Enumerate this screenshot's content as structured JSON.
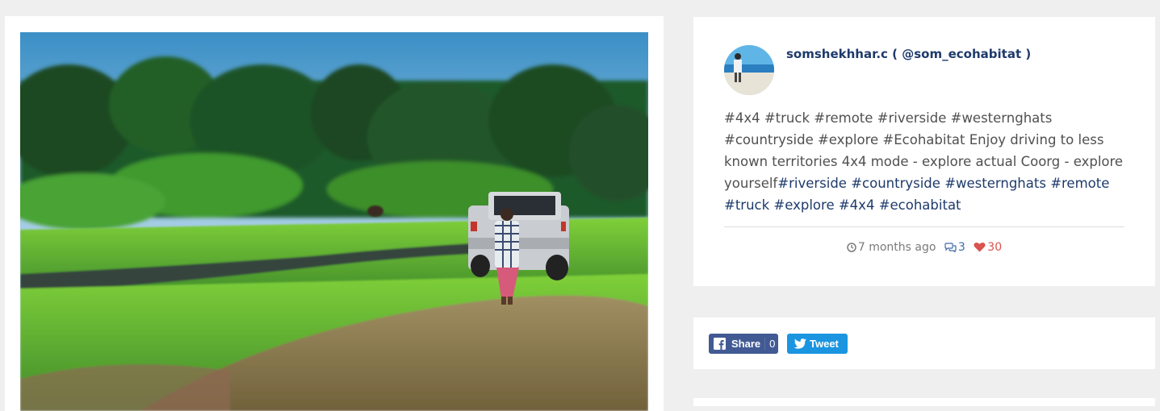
{
  "post": {
    "user_display": "somshekhhar.c ( @som_ecohabitat )",
    "caption_segments": [
      {
        "text": "#4x4 #truck #remote #riverside #westernghats #countryside #explore #Ecohabitat Enjoy driving to less known territories 4x4 mode - explore actual Coorg - explore yourself",
        "tag": false
      },
      {
        "text": "#riverside",
        "tag": true
      },
      {
        "text": " ",
        "tag": false
      },
      {
        "text": "#countryside",
        "tag": true
      },
      {
        "text": " ",
        "tag": false
      },
      {
        "text": "#westernghats",
        "tag": true
      },
      {
        "text": " ",
        "tag": false
      },
      {
        "text": "#remote",
        "tag": true
      },
      {
        "text": " ",
        "tag": false
      },
      {
        "text": "#truck",
        "tag": true
      },
      {
        "text": " ",
        "tag": false
      },
      {
        "text": "#explore",
        "tag": true
      },
      {
        "text": " ",
        "tag": false
      },
      {
        "text": "#4x4",
        "tag": true
      },
      {
        "text": " ",
        "tag": false
      },
      {
        "text": "#ecohabitat",
        "tag": true
      }
    ],
    "time_ago": "7 months ago",
    "comment_count": "3",
    "like_count": "30"
  },
  "share": {
    "facebook_label": "Share",
    "facebook_count": "0",
    "twitter_label": "Tweet"
  },
  "icons": {
    "clock": "clock-icon",
    "comments": "comments-icon",
    "heart": "heart-icon",
    "facebook": "facebook-icon",
    "twitter": "twitter-icon"
  },
  "colors": {
    "page_bg": "#efefef",
    "username": "#1e3a6b",
    "hashtag": "#1e3a6b",
    "likes": "#d9534f",
    "facebook": "#415a94",
    "twitter": "#1b95e0"
  }
}
